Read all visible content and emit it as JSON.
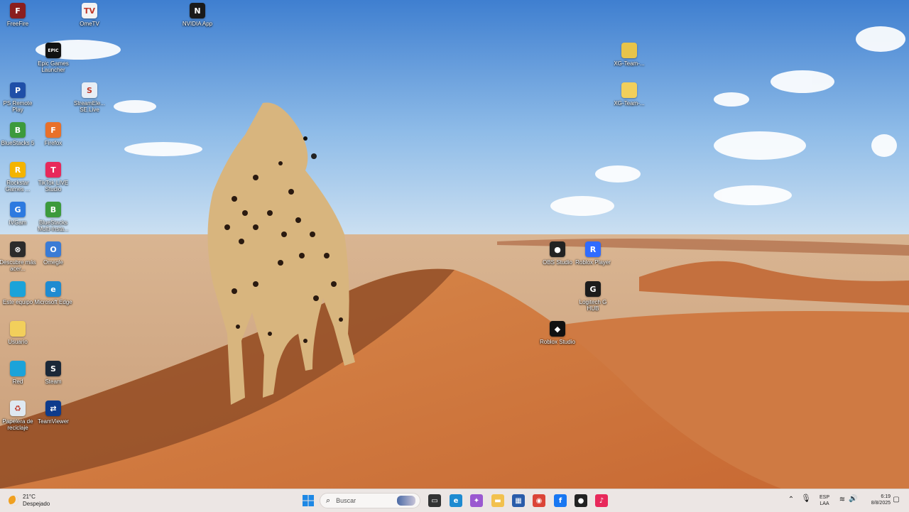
{
  "desktop": {
    "icons": [
      {
        "label": "FreeFire",
        "icon": "freefire-icon",
        "color": "#8b1e1e",
        "glyph": "F"
      },
      {
        "label": "OmeTV",
        "icon": "ometv-icon",
        "color": "#f3f3f3",
        "glyph": "TV"
      },
      {
        "label": "NVIDIA App",
        "icon": "nvidia-icon",
        "color": "#1a1a1a",
        "glyph": "N"
      },
      {
        "label": "Epic Games Launcher",
        "icon": "epic-games-icon",
        "color": "#111111",
        "glyph": "EPIC"
      },
      {
        "label": "XG-Team-...",
        "icon": "folder-zip-icon",
        "color": "#e8c44a",
        "glyph": ""
      },
      {
        "label": "PS Remote Play",
        "icon": "ps-remote-play-icon",
        "color": "#1f4fa8",
        "glyph": "P"
      },
      {
        "label": "StreamEle... SE.Live",
        "icon": "streamelements-icon",
        "color": "#e8eef5",
        "glyph": "S"
      },
      {
        "label": "XG-Team-...",
        "icon": "folder-icon",
        "color": "#f2cf5b",
        "glyph": ""
      },
      {
        "label": "BlueStacks 5",
        "icon": "bluestacks-icon",
        "color": "#3c9a3c",
        "glyph": "B"
      },
      {
        "label": "Firefox",
        "icon": "firefox-icon",
        "color": "#e8702a",
        "glyph": "F"
      },
      {
        "label": "Rockstar Games ...",
        "icon": "rockstar-icon",
        "color": "#f4b400",
        "glyph": "R"
      },
      {
        "label": "TikTok LIVE Studio",
        "icon": "tiktok-live-icon",
        "color": "#e8295b",
        "glyph": "T"
      },
      {
        "label": "IVGam",
        "icon": "ivgam-icon",
        "color": "#2d7ae0",
        "glyph": "G"
      },
      {
        "label": "BlueStacks Multi-Insta...",
        "icon": "bluestacks-multi-icon",
        "color": "#3c9a3c",
        "glyph": "B"
      },
      {
        "label": "Descubre más acer...",
        "icon": "discover-icon",
        "color": "#2b2b2b",
        "glyph": "⊗"
      },
      {
        "label": "Omegle",
        "icon": "omegle-icon",
        "color": "#3a7bd5",
        "glyph": "O"
      },
      {
        "label": "OBS Studio",
        "icon": "obs-icon",
        "color": "#222222",
        "glyph": "●"
      },
      {
        "label": "Roblox Player",
        "icon": "roblox-player-icon",
        "color": "#2f6bff",
        "glyph": "R"
      },
      {
        "label": "Este equipo",
        "icon": "this-pc-icon",
        "color": "#1ba3d9",
        "glyph": ""
      },
      {
        "label": "Microsoft Edge",
        "icon": "edge-icon",
        "color": "#1e8bd1",
        "glyph": "e"
      },
      {
        "label": "Logitech G HUB",
        "icon": "logitech-icon",
        "color": "#1b1b1b",
        "glyph": "G"
      },
      {
        "label": "Roblox Studio",
        "icon": "roblox-studio-icon",
        "color": "#111111",
        "glyph": "◆"
      },
      {
        "label": "Usuario",
        "icon": "user-folder-icon",
        "color": "#f2cf5b",
        "glyph": ""
      },
      {
        "label": "Red",
        "icon": "network-icon",
        "color": "#1ba3d9",
        "glyph": ""
      },
      {
        "label": "Steam",
        "icon": "steam-icon",
        "color": "#1b2838",
        "glyph": "S"
      },
      {
        "label": "Papelera de reciclaje",
        "icon": "recycle-bin-icon",
        "color": "#dfe9f2",
        "glyph": "♻"
      },
      {
        "label": "TeamViewer",
        "icon": "teamviewer-icon",
        "color": "#0e3b8c",
        "glyph": "⇄"
      }
    ]
  },
  "taskbar": {
    "weather": {
      "temp": "21°C",
      "condition": "Despejado",
      "icon": "moon-weather-icon"
    },
    "search": {
      "placeholder": "Buscar",
      "icon": "search-icon"
    },
    "apps": [
      {
        "name": "start-button",
        "icon": "windows-icon",
        "color": "#1e88e5"
      },
      {
        "name": "task-view-button",
        "icon": "task-view-icon",
        "color": "#333333"
      },
      {
        "name": "edge-taskbar-button",
        "icon": "edge-icon",
        "color": "#1e8bd1"
      },
      {
        "name": "copilot-taskbar-button",
        "icon": "copilot-icon",
        "color": "#9b59d0"
      },
      {
        "name": "file-explorer-button",
        "icon": "folder-icon",
        "color": "#f2c14e"
      },
      {
        "name": "store-taskbar-button",
        "icon": "store-icon",
        "color": "#2a5caa"
      },
      {
        "name": "chrome-taskbar-button",
        "icon": "chrome-icon",
        "color": "#db4437"
      },
      {
        "name": "facebook-taskbar-button",
        "icon": "facebook-icon",
        "color": "#1877f2"
      },
      {
        "name": "obs-taskbar-button",
        "icon": "obs-icon",
        "color": "#222222"
      },
      {
        "name": "tiktok-taskbar-button",
        "icon": "tiktok-icon",
        "color": "#e8295b"
      }
    ],
    "tray": {
      "language": "ESP",
      "layout": "LAA",
      "time": "6:19",
      "date": "8/8/2025"
    }
  }
}
